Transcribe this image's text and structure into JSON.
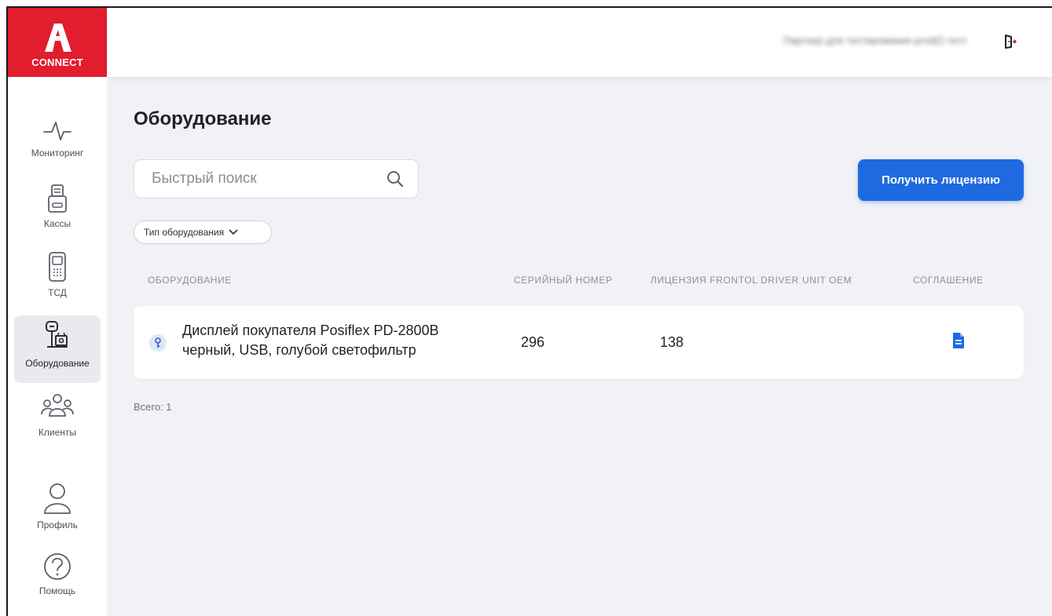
{
  "brand": {
    "name": "CONNECT",
    "color": "#e11d2e"
  },
  "sidebar": {
    "items": [
      {
        "label": "Мониторинг",
        "icon": "pulse-icon",
        "active": false
      },
      {
        "label": "Кассы",
        "icon": "cash-register-icon",
        "active": false
      },
      {
        "label": "ТСД",
        "icon": "scanner-terminal-icon",
        "active": false
      },
      {
        "label": "Оборудование",
        "icon": "equipment-scale-icon",
        "active": true
      },
      {
        "label": "Клиенты",
        "icon": "clients-group-icon",
        "active": false
      },
      {
        "label": "Профиль",
        "icon": "user-profile-icon",
        "active": false
      },
      {
        "label": "Помощь",
        "icon": "help-question-icon",
        "active": false
      }
    ]
  },
  "header": {
    "partner_name": "Партнер для тестирования prod(/) тест",
    "logout_icon": "logout-icon"
  },
  "main": {
    "title": "Оборудование",
    "search": {
      "placeholder": "Быстрый поиск",
      "icon": "search-icon"
    },
    "license_button": "Получить лицензию",
    "accent_color": "#1f6ae0",
    "filter": {
      "label": "Тип оборудования",
      "icon": "chevron-down-icon"
    },
    "table": {
      "columns": [
        "ОБОРУДОВАНИЕ",
        "СЕРИЙНЫЙ НОМЕР",
        "ЛИЦЕНЗИЯ FRONTOL DRIVER UNIT OEM",
        "СОГЛАШЕНИЕ"
      ],
      "rows": [
        {
          "name_line1": "Дисплей покупателя Posiflex PD-2800B",
          "name_line2": "черный, USB, голубой светофильтр",
          "serial": "296",
          "license": "138",
          "agreement_icon": "document-icon"
        }
      ]
    },
    "total": "Всего: 1"
  }
}
